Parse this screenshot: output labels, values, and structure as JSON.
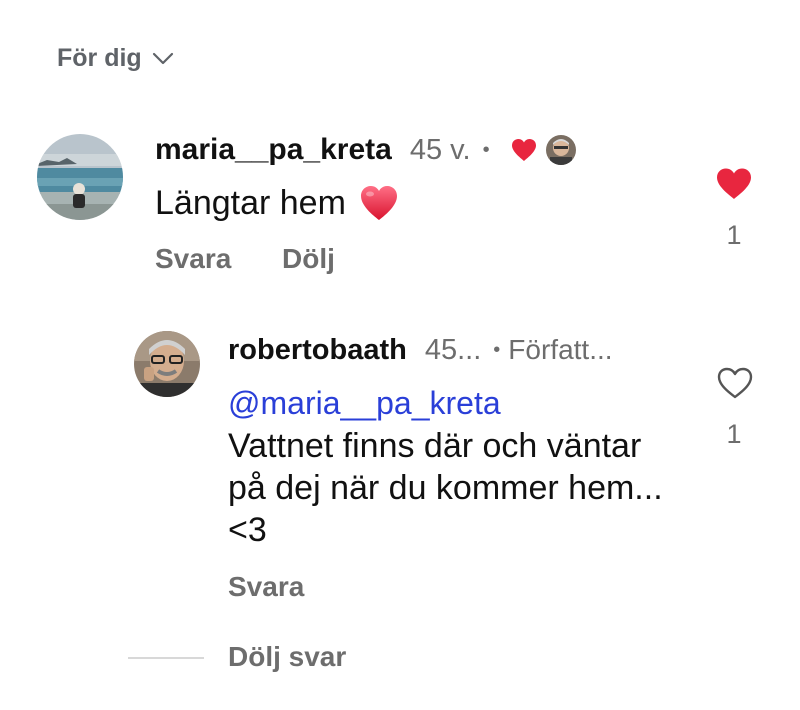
{
  "sort": {
    "label": "För dig",
    "icon": "chevron-down-icon"
  },
  "comments": [
    {
      "username": "maria__pa_kreta",
      "time": "45 v.",
      "separator": "•",
      "text": "Längtar hem",
      "emoji": "red-heart-emoji",
      "liked_by_author": true,
      "actions": {
        "reply": "Svara",
        "hide": "Dölj"
      },
      "likes": "1",
      "liked": true,
      "like_color": "#e8263f"
    }
  ],
  "replies": [
    {
      "username": "robertobaath",
      "time": "45...",
      "separator": "•",
      "tag": "Författ...",
      "mention": "@maria__pa_kreta",
      "text": "Vattnet finns där och väntar på dej när du kommer hem... <3",
      "actions": {
        "reply": "Svara"
      },
      "likes": "1",
      "liked": false
    }
  ],
  "hide_replies": "Dölj svar",
  "colors": {
    "mention": "#2a3fd8",
    "secondary_text": "#6d6d6d",
    "heart": "#e8263f"
  }
}
